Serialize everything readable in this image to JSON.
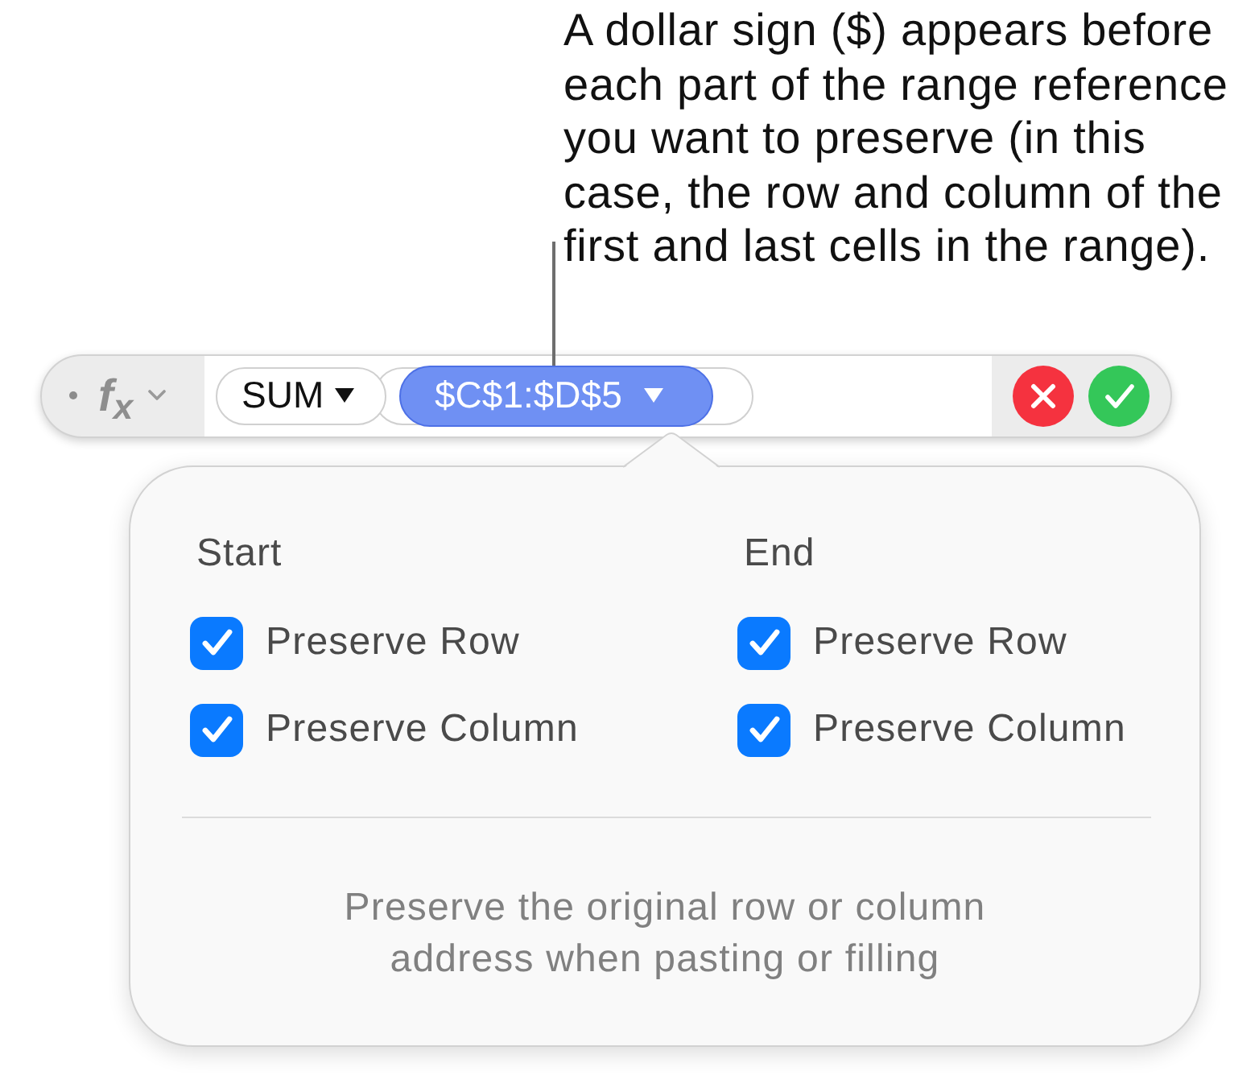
{
  "callout": {
    "text": "A dollar sign ($) appears before each part of the range reference you want to preserve (in this case, the row and column of the first and last cells in the range)."
  },
  "formula_bar": {
    "function_symbol": "f$_{x}$",
    "function_token": {
      "label": "SUM"
    },
    "range_token": {
      "label": "$C$1:$D$5",
      "selected": true
    }
  },
  "popover": {
    "columns": [
      {
        "heading": "Start",
        "options": [
          {
            "label": "Preserve Row",
            "checked": true
          },
          {
            "label": "Preserve Column",
            "checked": true
          }
        ]
      },
      {
        "heading": "End",
        "options": [
          {
            "label": "Preserve Row",
            "checked": true
          },
          {
            "label": "Preserve Column",
            "checked": true
          }
        ]
      }
    ],
    "note": "Preserve the original row or column address when pasting or filling"
  }
}
